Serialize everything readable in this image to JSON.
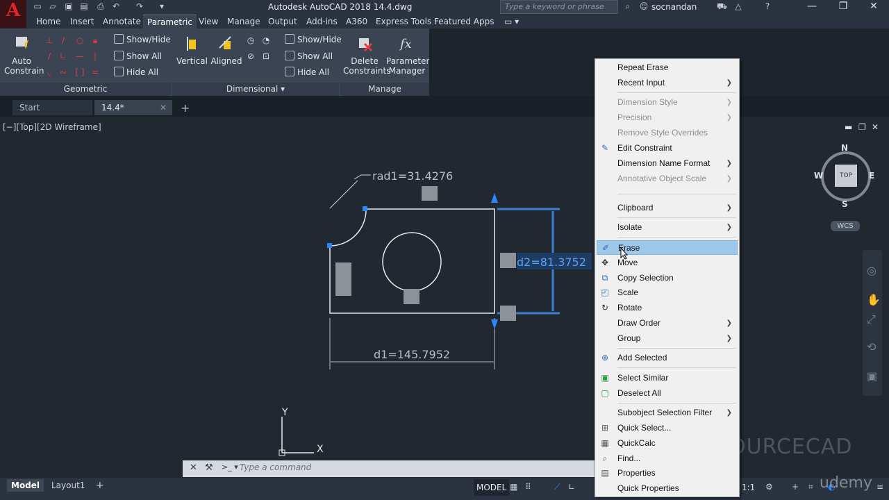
{
  "app": {
    "logo": "A",
    "title": "Autodesk AutoCAD 2018    14.4.dwg",
    "search_placeholder": "Type a keyword or phrase",
    "user": "socnandan"
  },
  "ribbon_tabs": [
    "Home",
    "Insert",
    "Annotate",
    "Parametric",
    "View",
    "Manage",
    "Output",
    "Add-ins",
    "A360",
    "Express Tools",
    "Featured Apps"
  ],
  "ribbon": {
    "auto_constrain": "Auto\nConstrain",
    "show_hide_1": "Show/Hide",
    "show_all_1": "Show All",
    "hide_all_1": "Hide All",
    "vertical": "Vertical",
    "aligned": "Aligned",
    "show_hide_2": "Show/Hide",
    "show_all_2": "Show All",
    "hide_all_2": "Hide All",
    "delete_constraints": "Delete\nConstraints",
    "parameters_manager": "Parameters\nManager",
    "panels": {
      "geometric": "Geometric",
      "dimensional": "Dimensional ▾",
      "manage": "Manage"
    }
  },
  "file_tabs": {
    "start": "Start",
    "current": "14.4*"
  },
  "viewport": {
    "label": "[−][Top][2D Wireframe]",
    "rad": "rad1=31.4276",
    "d1": "d1=145.7952",
    "d2": "d2=81.3752"
  },
  "viewcube": {
    "n": "N",
    "s": "S",
    "e": "E",
    "w": "W",
    "top": "TOP",
    "wcs": "WCS"
  },
  "ucs": {
    "x": "X",
    "y": "Y"
  },
  "command_line": {
    "placeholder": "Type a command"
  },
  "status": {
    "model_tab": "Model",
    "layout_tab": "Layout1",
    "add": "+",
    "model_space": "MODEL",
    "scale": "1:1"
  },
  "watermark": "SOURCECAD",
  "watermark2": "udemy",
  "context_menu": [
    {
      "label": "Repeat Erase",
      "disabled": false
    },
    {
      "label": "Recent Input",
      "submenu": true
    },
    {
      "label": "Dimension Style",
      "submenu": true,
      "disabled": true
    },
    {
      "label": "Precision",
      "submenu": true,
      "disabled": true
    },
    {
      "label": "Remove Style Overrides",
      "disabled": true
    },
    {
      "label": "Edit Constraint",
      "icon": "edit-constraint-icon"
    },
    {
      "label": "Dimension Name Format",
      "submenu": true
    },
    {
      "label": "Annotative Object Scale",
      "submenu": true,
      "disabled": true
    },
    {
      "label": "Clipboard",
      "submenu": true
    },
    {
      "label": "Isolate",
      "submenu": true
    },
    {
      "label": "Erase",
      "icon": "eraser-icon",
      "highlight": true
    },
    {
      "label": "Move",
      "icon": "move-icon"
    },
    {
      "label": "Copy Selection",
      "icon": "copy-icon"
    },
    {
      "label": "Scale",
      "icon": "scale-icon"
    },
    {
      "label": "Rotate",
      "icon": "rotate-icon"
    },
    {
      "label": "Draw Order",
      "submenu": true
    },
    {
      "label": "Group",
      "submenu": true
    },
    {
      "label": "Add Selected",
      "icon": "add-selected-icon"
    },
    {
      "label": "Select Similar",
      "icon": "select-similar-icon"
    },
    {
      "label": "Deselect All",
      "icon": "deselect-icon"
    },
    {
      "label": "Subobject Selection Filter",
      "submenu": true
    },
    {
      "label": "Quick Select...",
      "icon": "quick-select-icon"
    },
    {
      "label": "QuickCalc",
      "icon": "calculator-icon"
    },
    {
      "label": "Find...",
      "icon": "find-icon"
    },
    {
      "label": "Properties",
      "icon": "properties-icon"
    },
    {
      "label": "Quick Properties"
    }
  ]
}
